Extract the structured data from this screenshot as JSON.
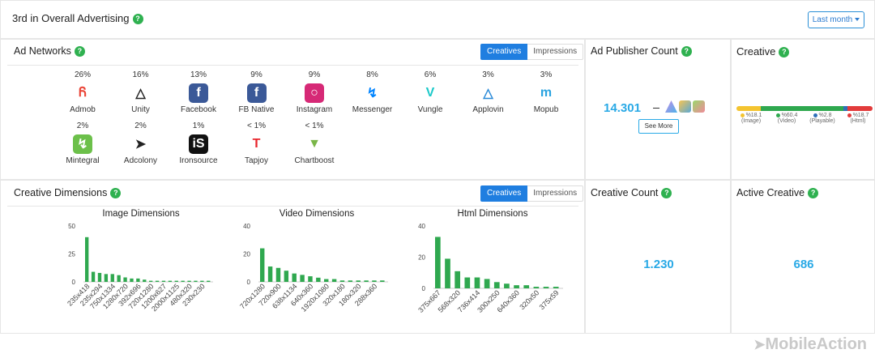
{
  "header": {
    "title": "3rd in Overall Advertising",
    "range_label": "Last month"
  },
  "ad_networks": {
    "title": "Ad Networks",
    "toggle": {
      "active": "Creatives",
      "inactive": "Impressions"
    },
    "items": [
      {
        "name": "Admob",
        "pct": "26%",
        "icon": "admob-icon",
        "color": "#ea4335"
      },
      {
        "name": "Unity",
        "pct": "16%",
        "icon": "unity-icon",
        "color": "#222222"
      },
      {
        "name": "Facebook",
        "pct": "13%",
        "icon": "facebook-icon",
        "color": "#3b5998"
      },
      {
        "name": "FB Native",
        "pct": "9%",
        "icon": "fb-native-icon",
        "color": "#3b5998"
      },
      {
        "name": "Instagram",
        "pct": "9%",
        "icon": "instagram-icon",
        "color": "#d62976"
      },
      {
        "name": "Messenger",
        "pct": "8%",
        "icon": "messenger-icon",
        "color": "#0084ff"
      },
      {
        "name": "Vungle",
        "pct": "6%",
        "icon": "vungle-icon",
        "color": "#1bc9c9"
      },
      {
        "name": "Applovin",
        "pct": "3%",
        "icon": "applovin-icon",
        "color": "#2a8ad8"
      },
      {
        "name": "Mopub",
        "pct": "3%",
        "icon": "mopub-icon",
        "color": "#2aa3e0"
      },
      {
        "name": "Mintegral",
        "pct": "2%",
        "icon": "mintegral-icon",
        "color": "#6cc04a"
      },
      {
        "name": "Adcolony",
        "pct": "2%",
        "icon": "adcolony-icon",
        "color": "#222222"
      },
      {
        "name": "Ironsource",
        "pct": "1%",
        "icon": "ironsource-icon",
        "color": "#111111"
      },
      {
        "name": "Tapjoy",
        "pct": "< 1%",
        "icon": "tapjoy-icon",
        "color": "#e8262d"
      },
      {
        "name": "Chartboost",
        "pct": "< 1%",
        "icon": "chartboost-icon",
        "color": "#7ab648"
      }
    ]
  },
  "publisher": {
    "title": "Ad Publisher Count",
    "value": "14.301",
    "see_more": "See More"
  },
  "creative": {
    "title": "Creative",
    "segments": [
      {
        "pct": "%18.1",
        "label": "(Image)",
        "value": 18.1,
        "color": "#f4c430"
      },
      {
        "pct": "%60.4",
        "label": "(Video)",
        "value": 60.4,
        "color": "#2fa84f"
      },
      {
        "pct": "%2.8",
        "label": "(Playable)",
        "value": 2.8,
        "color": "#2f6fb8"
      },
      {
        "pct": "%18.7",
        "label": "(Html)",
        "value": 18.7,
        "color": "#e23b3b"
      }
    ]
  },
  "dimensions": {
    "title": "Creative Dimensions",
    "toggle": {
      "active": "Creatives",
      "inactive": "Impressions"
    }
  },
  "creative_count": {
    "title": "Creative Count",
    "value": "1.230"
  },
  "active_creative": {
    "title": "Active Creative",
    "value": "686"
  },
  "watermark": "MobileAction",
  "chart_data": [
    {
      "type": "bar",
      "title": "Image Dimensions",
      "ylim": [
        0,
        50
      ],
      "yticks": [
        0,
        25,
        50
      ],
      "color": "#2fa84f",
      "categories": [
        "235x418",
        "",
        "235x294",
        "",
        "750x1334",
        "",
        "1280x720",
        "",
        "392x696",
        "",
        "720x1280",
        "",
        "1200x627",
        "",
        "2000x1125",
        "",
        "480x320",
        "",
        "230x230",
        ""
      ],
      "values": [
        40,
        9,
        8,
        7,
        7,
        6,
        4,
        3,
        3,
        2,
        1,
        1,
        1,
        1,
        1,
        1,
        1,
        1,
        1,
        1
      ]
    },
    {
      "type": "bar",
      "title": "Video Dimensions",
      "ylim": [
        0,
        40
      ],
      "yticks": [
        0,
        20,
        40
      ],
      "color": "#2fa84f",
      "categories": [
        "720x1280",
        "",
        "720x900",
        "",
        "638x1134",
        "",
        "640x360",
        "",
        "1920x1080",
        "",
        "320x180",
        "",
        "180x320",
        "",
        "288x360",
        ""
      ],
      "values": [
        24,
        11,
        10,
        8,
        6,
        5,
        4,
        3,
        2,
        2,
        1,
        1,
        1,
        1,
        1,
        1
      ]
    },
    {
      "type": "bar",
      "title": "Html Dimensions",
      "ylim": [
        0,
        40
      ],
      "yticks": [
        0,
        20,
        40
      ],
      "color": "#2fa84f",
      "categories": [
        "375x667",
        "",
        "568x320",
        "",
        "736x414",
        "",
        "300x250",
        "",
        "640x360",
        "",
        "320x50",
        "",
        "375x59"
      ],
      "values": [
        33,
        19,
        11,
        7,
        7,
        6,
        4,
        3,
        2,
        2,
        1,
        1,
        1
      ]
    }
  ]
}
